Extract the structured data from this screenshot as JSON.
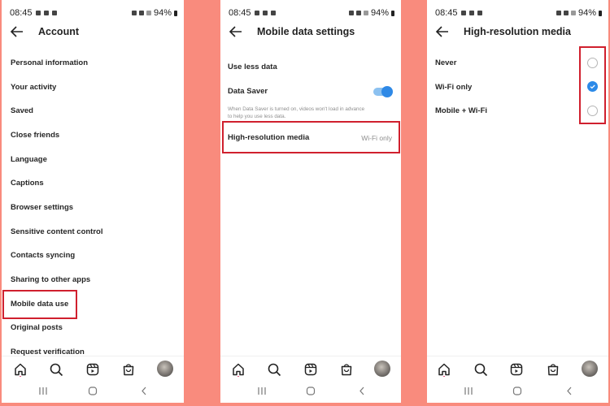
{
  "status_bar": {
    "time": "08:45",
    "battery": "94%"
  },
  "screen1": {
    "title": "Account",
    "items": [
      "Personal information",
      "Your activity",
      "Saved",
      "Close friends",
      "Language",
      "Captions",
      "Browser settings",
      "Sensitive content control",
      "Contacts syncing",
      "Sharing to other apps",
      "Mobile data use",
      "Original posts",
      "Request verification"
    ],
    "highlighted_item": "Mobile data use"
  },
  "screen2": {
    "title": "Mobile data settings",
    "section_label": "Use less data",
    "data_saver": {
      "label": "Data Saver",
      "enabled": true,
      "description_line1": "When Data Saver is turned on, videos won't load in advance",
      "description_line2": "to help you use less data."
    },
    "high_res": {
      "label": "High-resolution media",
      "value": "Wi-Fi only"
    }
  },
  "screen3": {
    "title": "High-resolution media",
    "options": [
      {
        "label": "Never",
        "selected": false
      },
      {
        "label": "Wi-Fi only",
        "selected": true
      },
      {
        "label": "Mobile + Wi-Fi",
        "selected": false
      }
    ]
  },
  "bottom_nav": [
    "home",
    "search",
    "reels",
    "shop",
    "profile"
  ],
  "colors": {
    "accent": "#2c8ae8",
    "highlight_box": "#d0202e",
    "background": "#f98b7d"
  }
}
